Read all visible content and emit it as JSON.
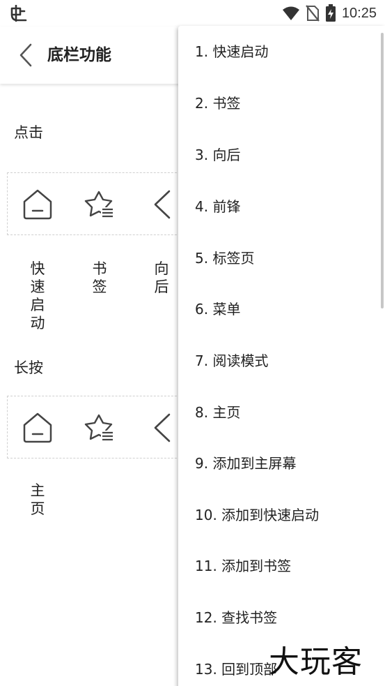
{
  "status_bar": {
    "time": "10:25"
  },
  "header": {
    "title": "底栏功能"
  },
  "click_section": {
    "title": "点击",
    "items": [
      "快速启动",
      "书签",
      "向后"
    ]
  },
  "long_press_section": {
    "title": "长按",
    "items": [
      "主页"
    ]
  },
  "menu": {
    "items": [
      "1. 快速启动",
      "2. 书签",
      "3. 向后",
      "4. 前锋",
      "5. 标签页",
      "6. 菜单",
      "7. 阅读模式",
      "8. 主页",
      "9. 添加到主屏幕",
      "10. 添加到快速启动",
      "11. 添加到书签",
      "12. 查找书签",
      "13. 回到顶部"
    ]
  },
  "watermark": {
    "text": "大玩客"
  },
  "icons": {
    "status_app": "bug-icon",
    "wifi": "wifi-icon",
    "sim": "no-sim-icon",
    "battery": "battery-charging-icon",
    "back": "chevron-left-icon",
    "home": "home-icon",
    "bookmarks": "star-list-icon",
    "back_nav": "chevron-left-icon"
  },
  "colors": {
    "text": "#222222",
    "icon": "#444444",
    "dash": "#cfcfcf"
  }
}
